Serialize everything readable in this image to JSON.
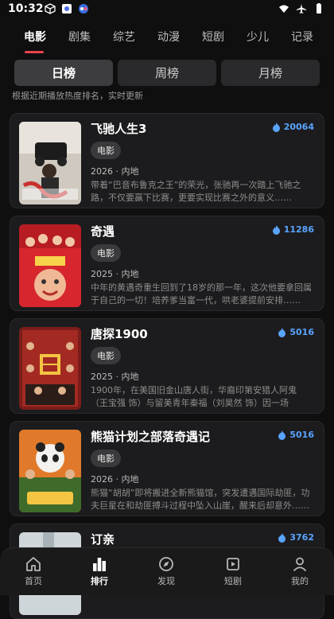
{
  "status": {
    "time": "10:32"
  },
  "categories": [
    {
      "label": "电影",
      "active": true
    },
    {
      "label": "剧集"
    },
    {
      "label": "综艺"
    },
    {
      "label": "动漫"
    },
    {
      "label": "短剧"
    },
    {
      "label": "少儿"
    },
    {
      "label": "记录"
    }
  ],
  "segments": [
    {
      "label": "日榜",
      "active": true
    },
    {
      "label": "周榜"
    },
    {
      "label": "月榜"
    }
  ],
  "hint": "根据近期播放热度排名，实时更新",
  "items": [
    {
      "title": "飞驰人生3",
      "heat": "20064",
      "tag": "电影",
      "meta": "2026 · 内地",
      "desc": "带着“巴音布鲁克之王”的荣光，张驰再一次踏上飞驰之路，不仅要赢下比赛，更要实现比赛之外的意义……"
    },
    {
      "title": "奇遇",
      "heat": "11286",
      "tag": "电影",
      "meta": "2025 · 内地",
      "desc": "中年的黄遇奇重生回到了18岁的那一年，这次他要拿回属于自己的一切！培养爹当富一代，哄老婆提前安排……"
    },
    {
      "title": "唐探1900",
      "heat": "5016",
      "tag": "电影",
      "meta": "2025 · 内地",
      "desc": "1900年，在美国旧金山唐人街，华裔印第安猎人阿鬼（王宝强 饰）与留美青年秦福（刘昊然 饰）因一场凶……"
    },
    {
      "title": "熊猫计划之部落奇遇记",
      "heat": "5016",
      "tag": "电影",
      "meta": "2026 · 内地",
      "desc": "熊猫“胡胡”即将搬进全新熊猫馆，突发遭遇国际劫匪，功夫巨星在和劫匪搏斗过程中坠入山崖，醒来后却意外……"
    },
    {
      "title": "订亲",
      "heat": "3762"
    }
  ],
  "nav": [
    {
      "label": "首页"
    },
    {
      "label": "排行",
      "active": true
    },
    {
      "label": "发现"
    },
    {
      "label": "短剧"
    },
    {
      "label": "我的"
    }
  ],
  "colors": {
    "accent_red": "#e8434b",
    "heat_blue": "#5aa4ff",
    "card_bg": "#1c1c1e",
    "page_bg": "#0f0f10"
  }
}
